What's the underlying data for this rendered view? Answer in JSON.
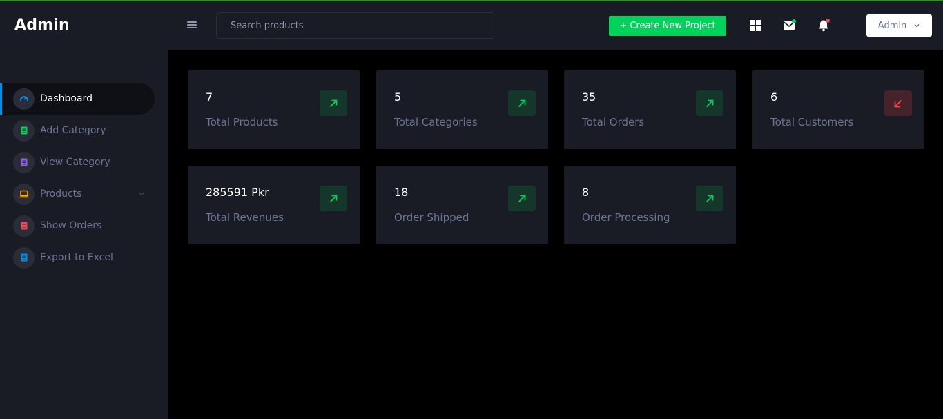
{
  "app": {
    "brand": "Admin"
  },
  "header": {
    "search_placeholder": "Search products",
    "create_button": "+ Create New Project",
    "user_label": "Admin",
    "icons": [
      "grid-icon",
      "mail-icon",
      "bell-icon"
    ],
    "colors": {
      "create": "#00d25b",
      "mail_dot": "#00d25b",
      "bell_dot": "#fc424a"
    }
  },
  "sidebar": {
    "items": [
      {
        "label": "Dashboard",
        "icon": "speedometer-icon",
        "color": "#0090e7",
        "active": true
      },
      {
        "label": "Add Category",
        "icon": "document-icon",
        "color": "#00d25b"
      },
      {
        "label": "View Category",
        "icon": "document-icon",
        "color": "#8f5fe8"
      },
      {
        "label": "Products",
        "icon": "laptop-icon",
        "color": "#ffab00",
        "has_submenu": true
      },
      {
        "label": "Show Orders",
        "icon": "document-icon",
        "color": "#fc424a"
      },
      {
        "label": "Export to Excel",
        "icon": "document-icon",
        "color": "#0090e7"
      }
    ]
  },
  "stats": [
    {
      "value": "7",
      "label": "Total Products",
      "trend": "up"
    },
    {
      "value": "5",
      "label": "Total Categories",
      "trend": "up"
    },
    {
      "value": "35",
      "label": "Total Orders",
      "trend": "up"
    },
    {
      "value": "6",
      "label": "Total Customers",
      "trend": "down"
    },
    {
      "value": "285591 Pkr",
      "label": "Total Revenues",
      "trend": "up"
    },
    {
      "value": "18",
      "label": "Order Shipped",
      "trend": "up"
    },
    {
      "value": "8",
      "label": "Order Processing",
      "trend": "up"
    }
  ]
}
